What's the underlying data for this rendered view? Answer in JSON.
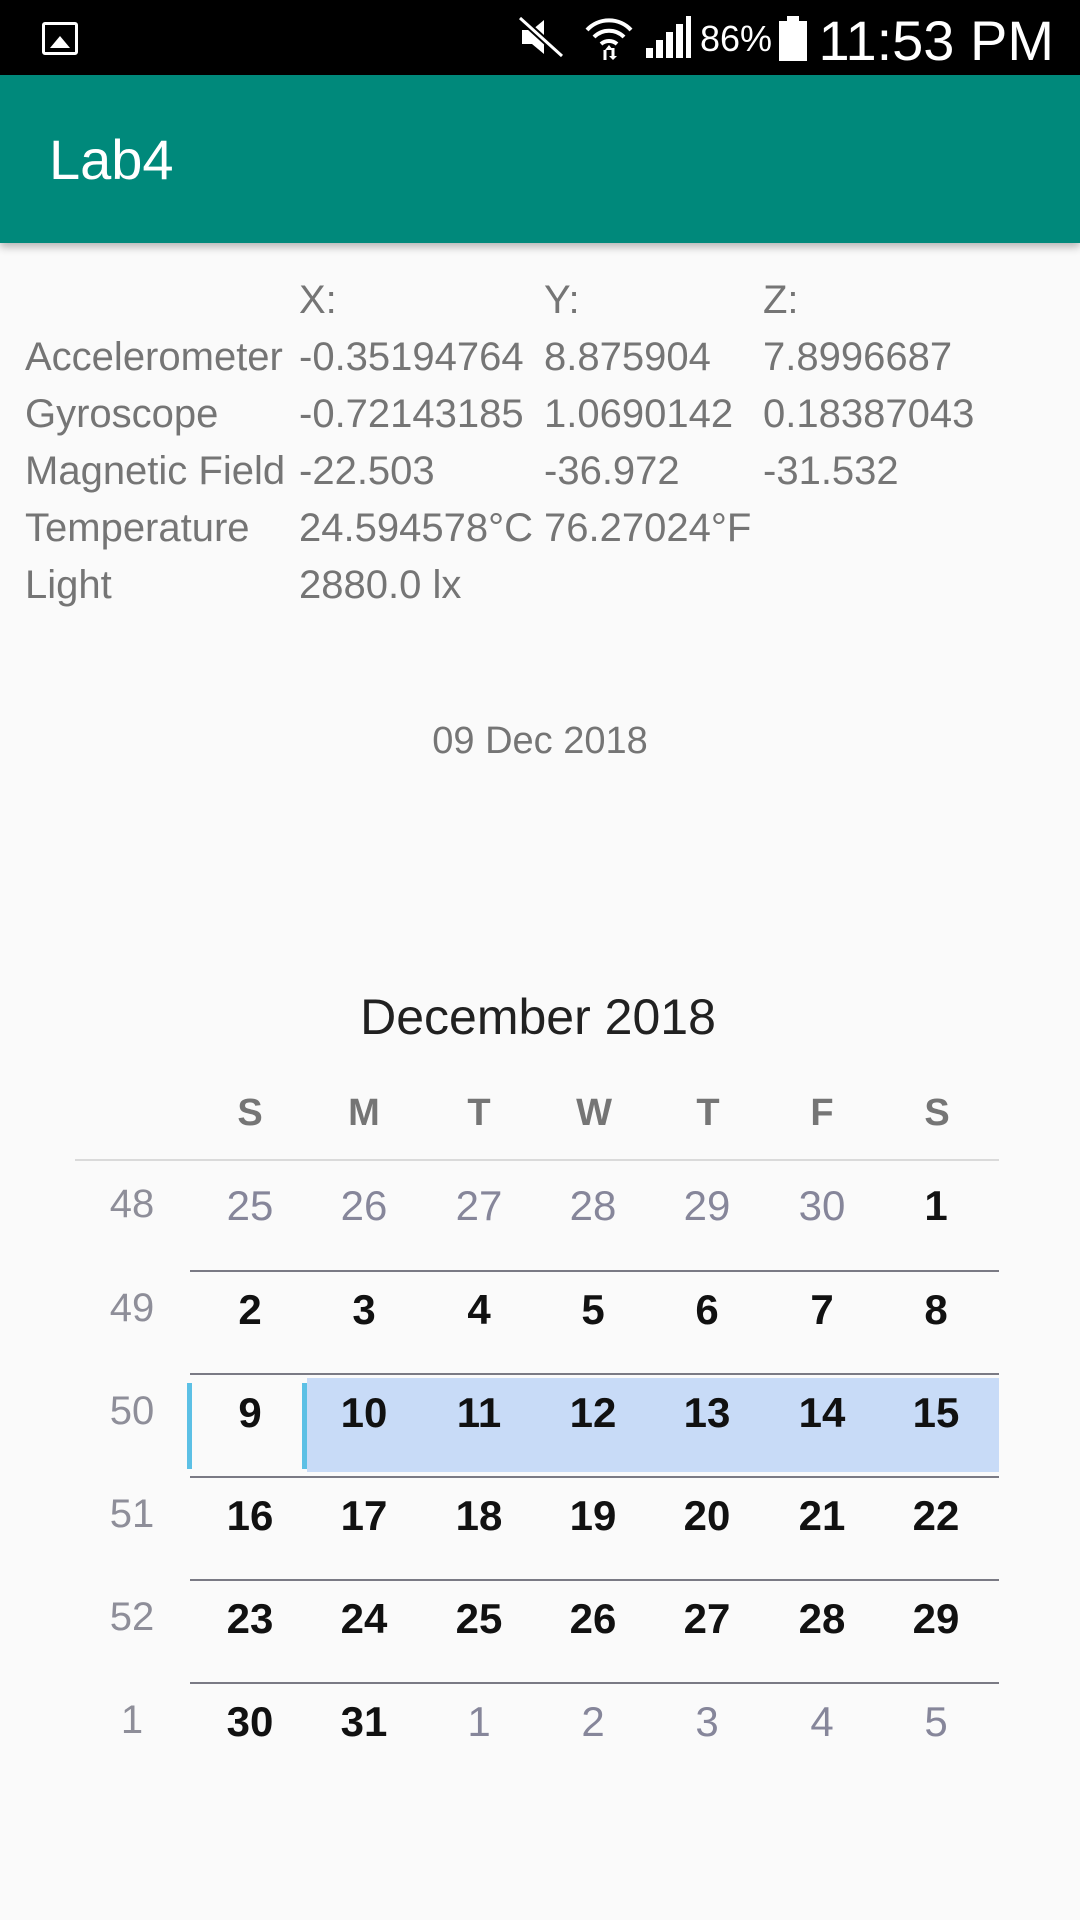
{
  "status_bar": {
    "battery_percent": "86%",
    "time": "11:53 PM",
    "icons": [
      "gallery-icon",
      "mute-icon",
      "wifi-icon",
      "signal-icon",
      "battery-icon"
    ]
  },
  "app_bar": {
    "title": "Lab4",
    "color": "#00897b"
  },
  "sensors": {
    "headers": [
      "",
      "X:",
      "Y:",
      "Z:"
    ],
    "rows": [
      [
        "Accelerometer",
        "-0.35194764",
        "8.875904",
        "7.8996687"
      ],
      [
        "Gyroscope",
        "-0.72143185",
        "1.0690142",
        "0.18387043"
      ],
      [
        "Magnetic Field",
        "-22.503",
        "-36.972",
        "-31.532"
      ],
      [
        "Temperature",
        "24.594578°C",
        "76.27024°F",
        ""
      ],
      [
        "Light",
        "2880.0 lx",
        "",
        ""
      ]
    ]
  },
  "date_text": "09 Dec 2018",
  "calendar": {
    "month_title": "December 2018",
    "days_of_week": [
      "S",
      "M",
      "T",
      "W",
      "T",
      "F",
      "S"
    ],
    "selected_day": "9",
    "highlight_color": "#c8dbf7",
    "weeks": [
      {
        "week": "48",
        "days": [
          "25",
          "26",
          "27",
          "28",
          "29",
          "30",
          "1"
        ],
        "muted": [
          true,
          true,
          true,
          true,
          true,
          true,
          false
        ]
      },
      {
        "week": "49",
        "days": [
          "2",
          "3",
          "4",
          "5",
          "6",
          "7",
          "8"
        ],
        "muted": [
          false,
          false,
          false,
          false,
          false,
          false,
          false
        ]
      },
      {
        "week": "50",
        "days": [
          "9",
          "10",
          "11",
          "12",
          "13",
          "14",
          "15"
        ],
        "muted": [
          false,
          false,
          false,
          false,
          false,
          false,
          false
        ]
      },
      {
        "week": "51",
        "days": [
          "16",
          "17",
          "18",
          "19",
          "20",
          "21",
          "22"
        ],
        "muted": [
          false,
          false,
          false,
          false,
          false,
          false,
          false
        ]
      },
      {
        "week": "52",
        "days": [
          "23",
          "24",
          "25",
          "26",
          "27",
          "28",
          "29"
        ],
        "muted": [
          false,
          false,
          false,
          false,
          false,
          false,
          false
        ]
      },
      {
        "week": "1",
        "days": [
          "30",
          "31",
          "1",
          "2",
          "3",
          "4",
          "5"
        ],
        "muted": [
          false,
          false,
          true,
          true,
          true,
          true,
          true
        ]
      }
    ]
  }
}
